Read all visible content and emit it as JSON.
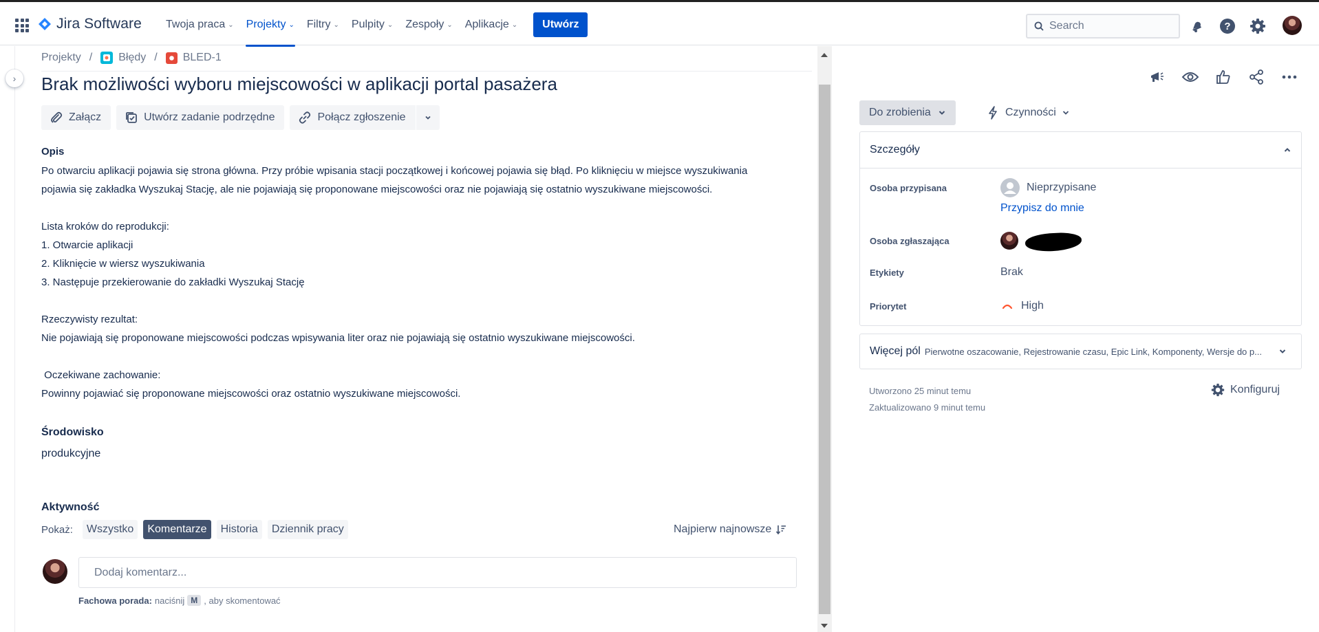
{
  "header": {
    "product_name": "Jira Software",
    "nav": [
      {
        "label": "Twoja praca",
        "active": false
      },
      {
        "label": "Projekty",
        "active": true
      },
      {
        "label": "Filtry",
        "active": false
      },
      {
        "label": "Pulpity",
        "active": false
      },
      {
        "label": "Zespoły",
        "active": false
      },
      {
        "label": "Aplikacje",
        "active": false
      }
    ],
    "create_label": "Utwórz",
    "search_placeholder": "Search",
    "icons": [
      "notification-icon",
      "help-icon",
      "settings-icon",
      "avatar"
    ]
  },
  "breadcrumb": {
    "projects": "Projekty",
    "project": "Błędy",
    "issue_key": "BLED-1"
  },
  "issue": {
    "title": "Brak możliwości wyboru miejscowości w aplikacji portal pasażera",
    "actions": {
      "attach": "Załącz",
      "create_subtask": "Utwórz zadanie podrzędne",
      "link_issue": "Połącz zgłoszenie"
    },
    "description_label": "Opis",
    "description_lines": [
      "Po otwarciu aplikacji pojawia się strona główna. Przy próbie wpisania stacji początkowej i końcowej pojawia się błąd. Po kliknięciu w miejsce wyszukiwania",
      "pojawia się zakładka Wyszukaj Stację, ale nie pojawiają się proponowane miejscowości oraz nie pojawiają się ostatnio wyszukiwane miejscowości.",
      "",
      "Lista kroków do reprodukcji:",
      "1. Otwarcie aplikacji",
      "2. Kliknięcie w wiersz wyszukiwania",
      "3. Następuje przekierowanie do zakładki Wyszukaj Stację",
      "",
      "Rzeczywisty rezultat:",
      "Nie pojawiają się proponowane miejscowości podczas wpisywania liter oraz nie pojawiają się ostatnio wyszukiwane miejscowości.",
      "",
      " Oczekiwane zachowanie:",
      "Powinny pojawiać się proponowane miejscowości oraz ostatnio wyszukiwane miejscowości."
    ],
    "environment_label": "Środowisko",
    "environment_value": "produkcyjne"
  },
  "activity": {
    "label": "Aktywność",
    "show_label": "Pokaż:",
    "filters": [
      {
        "label": "Wszystko",
        "active": false
      },
      {
        "label": "Komentarze",
        "active": true
      },
      {
        "label": "Historia",
        "active": false
      },
      {
        "label": "Dziennik pracy",
        "active": false
      }
    ],
    "sort_label": "Najpierw najnowsze",
    "comment_placeholder": "Dodaj komentarz...",
    "tip_bold": "Fachowa porada:",
    "tip_pre": "naciśnij",
    "tip_key": "M",
    "tip_post": ", aby skomentować"
  },
  "sidebar": {
    "status": "Do zrobienia",
    "actions": "Czynności",
    "details_title": "Szczegóły",
    "fields": {
      "assignee_label": "Osoba przypisana",
      "assignee_value": "Nieprzypisane",
      "assign_to_me": "Przypisz do mnie",
      "reporter_label": "Osoba zgłaszająca",
      "labels_label": "Etykiety",
      "labels_value": "Brak",
      "priority_label": "Priorytet",
      "priority_value": "High"
    },
    "more_fields_title": "Więcej pól",
    "more_fields_list": "Pierwotne oszacowanie, Rejestrowanie czasu, Epic Link, Komponenty, Wersje do p...",
    "created": "Utworzono 25 minut temu",
    "updated": "Zaktualizowano 9 minut temu",
    "configure": "Konfiguruj"
  },
  "colors": {
    "brand": "#0052cc",
    "text": "#172b4d",
    "subtle": "#42526e",
    "priority_high": "#ff5630",
    "project_icon": "#00b8d9",
    "bug_icon": "#e5493a"
  }
}
